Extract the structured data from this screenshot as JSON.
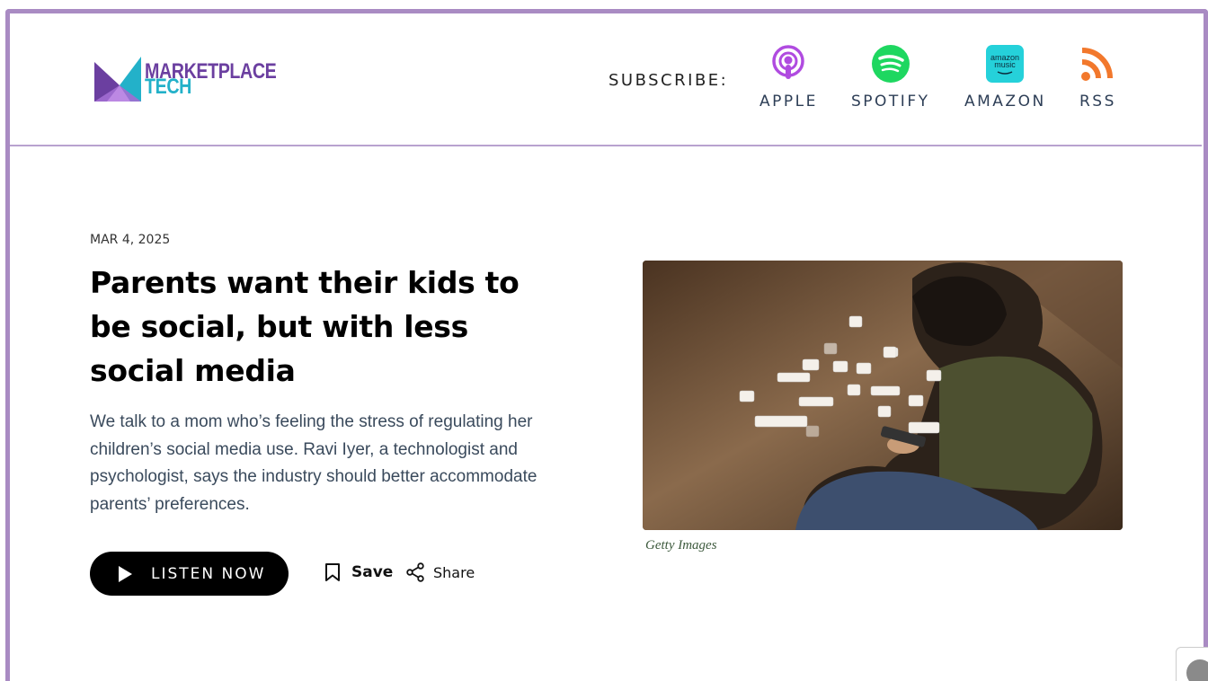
{
  "brand": {
    "line1": "MARKETPLACE",
    "line2": "TECH",
    "colors": {
      "purple": "#6b3fa0",
      "teal": "#23b1c9",
      "frame": "#a98bc3"
    }
  },
  "subscribe": {
    "label": "SUBSCRIBE:",
    "items": [
      {
        "label": "APPLE",
        "icon": "apple-podcasts-icon",
        "color": "#b04be0"
      },
      {
        "label": "SPOTIFY",
        "icon": "spotify-icon",
        "color": "#1ed760"
      },
      {
        "label": "AMAZON",
        "icon": "amazon-music-icon",
        "color": "#25d1da",
        "badge_line1": "amazon",
        "badge_line2": "music"
      },
      {
        "label": "RSS",
        "icon": "rss-icon",
        "color": "#f2782c"
      }
    ]
  },
  "article": {
    "date": "MAR 4, 2025",
    "title": "Parents want their kids to be social, but with less social media",
    "description": "We talk to a mom who’s feeling the stress of regulating her children’s social media use. Ravi Iyer, a technologist and psychologist, says the industry should better accommodate parents’ preferences.",
    "listen_label": "LISTEN NOW",
    "save_label": "Save",
    "share_label": "Share",
    "image_caption": "Getty Images"
  }
}
